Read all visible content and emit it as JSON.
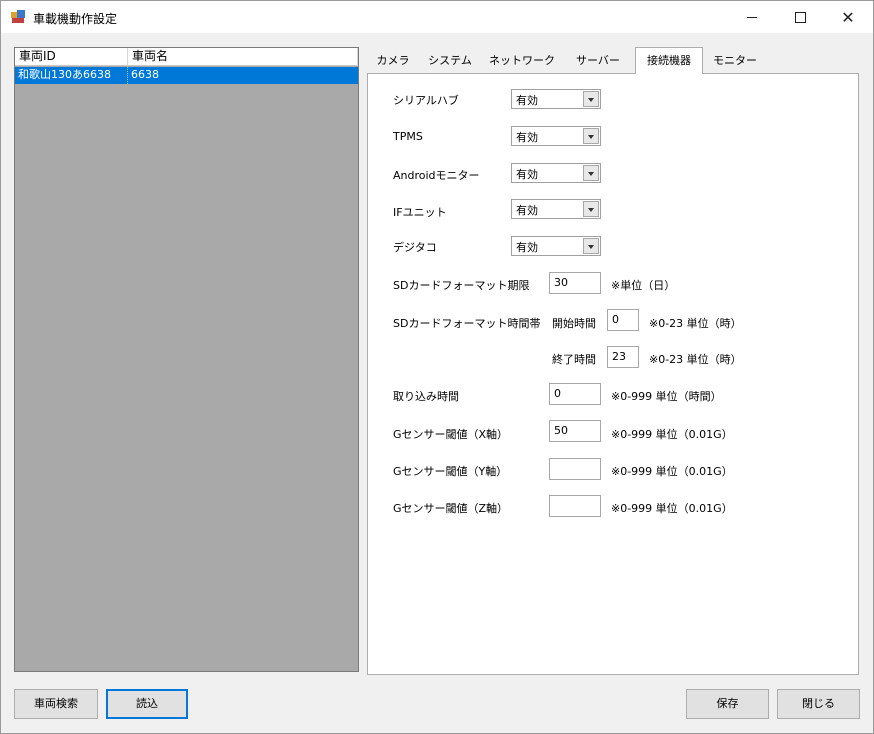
{
  "window": {
    "title": "車載機動作設定"
  },
  "vehicle_list": {
    "columns": [
      "車両ID",
      "車両名"
    ],
    "rows": [
      {
        "id": "和歌山130あ6638",
        "name": "6638"
      }
    ]
  },
  "tabs": [
    "カメラ",
    "システム",
    "ネットワーク",
    "サーバー",
    "接続機器",
    "モニター"
  ],
  "active_tab": "接続機器",
  "devices": [
    {
      "label": "シリアルハブ",
      "value": "有効"
    },
    {
      "label": "TPMS",
      "value": "有効"
    },
    {
      "label": "Androidモニター",
      "value": "有効"
    },
    {
      "label": "IFユニット",
      "value": "有効"
    },
    {
      "label": "デジタコ",
      "value": "有効"
    }
  ],
  "sd_period": {
    "label": "SDカードフォーマット期限",
    "value": "30",
    "unit": "※単位（日）"
  },
  "sd_time": {
    "label": "SDカードフォーマット時間帯",
    "start_label": "開始時間",
    "start_value": "0",
    "start_unit": "※0-23 単位（時）",
    "end_label": "終了時間",
    "end_value": "23",
    "end_unit": "※0-23 単位（時）"
  },
  "capture_time": {
    "label": "取り込み時間",
    "value": "0",
    "unit": "※0-999 単位（時間）"
  },
  "g_sensors": [
    {
      "label": "Gセンサー閾値（X軸）",
      "value": "50",
      "unit": "※0-999 単位（0.01G）"
    },
    {
      "label": "Gセンサー閾値（Y軸）",
      "value": "",
      "unit": "※0-999 単位（0.01G）"
    },
    {
      "label": "Gセンサー閾値（Z軸）",
      "value": "",
      "unit": "※0-999 単位（0.01G）"
    }
  ],
  "buttons": {
    "search": "車両検索",
    "load": "読込",
    "save": "保存",
    "close": "閉じる"
  },
  "icons": {
    "app": "app-icon",
    "minimize": "minimize-icon",
    "maximize": "maximize-icon",
    "close": "close-icon",
    "dropdown": "chevron-down-icon"
  },
  "colors": {
    "selection": "#0078d7",
    "list_background": "#a9a9a9",
    "focus_border": "#0078d7"
  }
}
